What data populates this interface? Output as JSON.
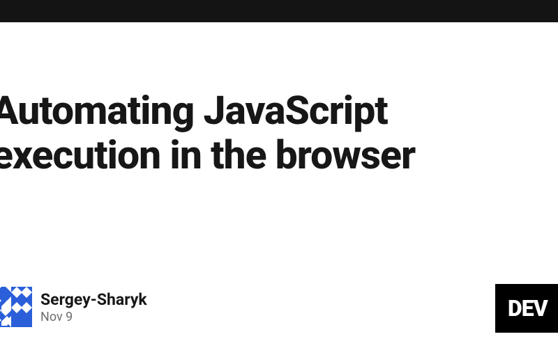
{
  "article": {
    "title": "Automating JavaScript execution in the browser"
  },
  "author": {
    "name": "Sergey-Sharyk",
    "date": "Nov 9"
  },
  "badge": {
    "text": "DEV"
  }
}
